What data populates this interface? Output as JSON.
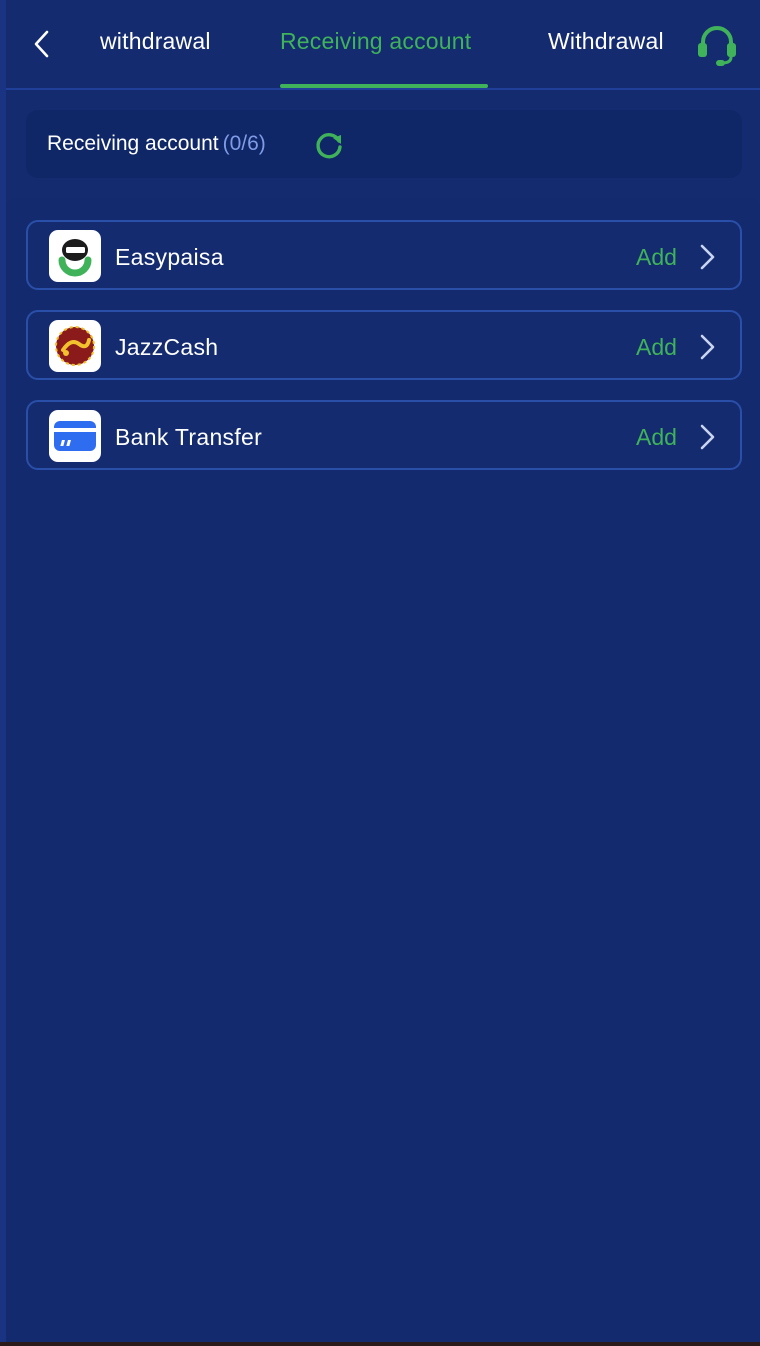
{
  "header": {
    "back_icon": "chevron-left-icon",
    "tabs": [
      {
        "label": "withdrawal",
        "active": false
      },
      {
        "label": "Receiving account",
        "active": true
      },
      {
        "label": "Withdrawal",
        "active": false
      }
    ],
    "support_icon": "headset-icon"
  },
  "summary": {
    "label": "Receiving account",
    "count": "(0/6)",
    "refresh_icon": "refresh-icon"
  },
  "methods": [
    {
      "name": "Easypaisa",
      "action": "Add",
      "logo": "easypaisa-logo"
    },
    {
      "name": "JazzCash",
      "action": "Add",
      "logo": "jazzcash-logo"
    },
    {
      "name": "Bank Transfer",
      "action": "Add",
      "logo": "bank-card-icon"
    }
  ],
  "colors": {
    "background": "#142b70",
    "accent": "#3fb25a",
    "count": "#7f9be6",
    "border": "#2a4fa8"
  }
}
